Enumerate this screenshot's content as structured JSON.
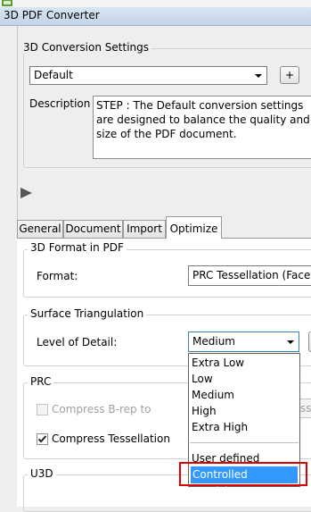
{
  "window": {
    "title": "3D PDF Converter"
  },
  "conversion_settings": {
    "legend": "3D Conversion Settings",
    "preset_value": "Default",
    "add_button_label": "+",
    "description_label": "Description",
    "description_text": "STEP : The Default conversion settings are designed to balance the quality and size of the PDF document."
  },
  "tabs": [
    "General",
    "Document",
    "Import",
    "Optimize"
  ],
  "active_tab": "Optimize",
  "optimize": {
    "format_group": {
      "legend": "3D Format in PDF",
      "format_label": "Format:",
      "format_value": "PRC Tessellation (Faceted)"
    },
    "surface_group": {
      "legend": "Surface Triangulation",
      "lod_label": "Level of Detail:",
      "lod_value": "Medium"
    },
    "prc_group": {
      "legend": "PRC",
      "compress_brep_label": "Compress B-rep to",
      "compress_brep_checked": false,
      "compress_brep_enabled": false,
      "compress_brep_value_fragment": "ssi",
      "compress_tessellation_label": "Compress Tessellation",
      "compress_tessellation_checked": true
    },
    "u3d_group": {
      "legend": "U3D"
    }
  },
  "lod_dropdown": {
    "options": [
      "Extra Low",
      "Low",
      "Medium",
      "High",
      "Extra High",
      "User defined",
      "Controlled precision"
    ],
    "selected": "Controlled precision"
  },
  "colors": {
    "selection": "#3399ff",
    "highlight_box": "#e00000"
  }
}
